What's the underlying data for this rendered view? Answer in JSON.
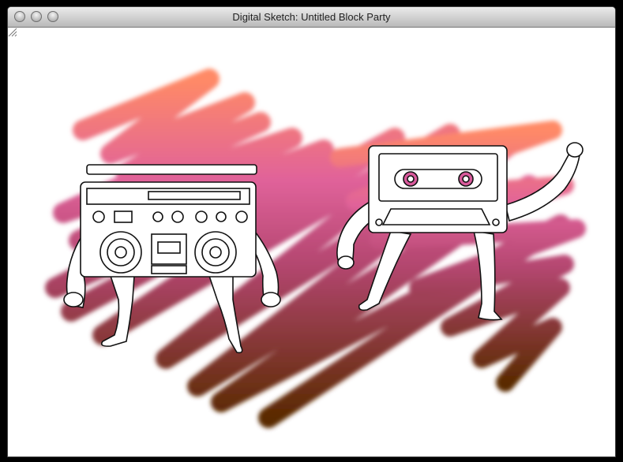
{
  "window": {
    "title": "Digital Sketch: Untitled Block Party"
  },
  "colors": {
    "scribble_top": "#ff8a66",
    "scribble_mid": "#d95a9c",
    "scribble_bottom": "#5a2a00",
    "ink": "#111111"
  },
  "icons": {
    "close": "close-icon",
    "minimize": "minimize-icon",
    "zoom": "zoom-icon",
    "resize": "resize-grip-icon"
  }
}
